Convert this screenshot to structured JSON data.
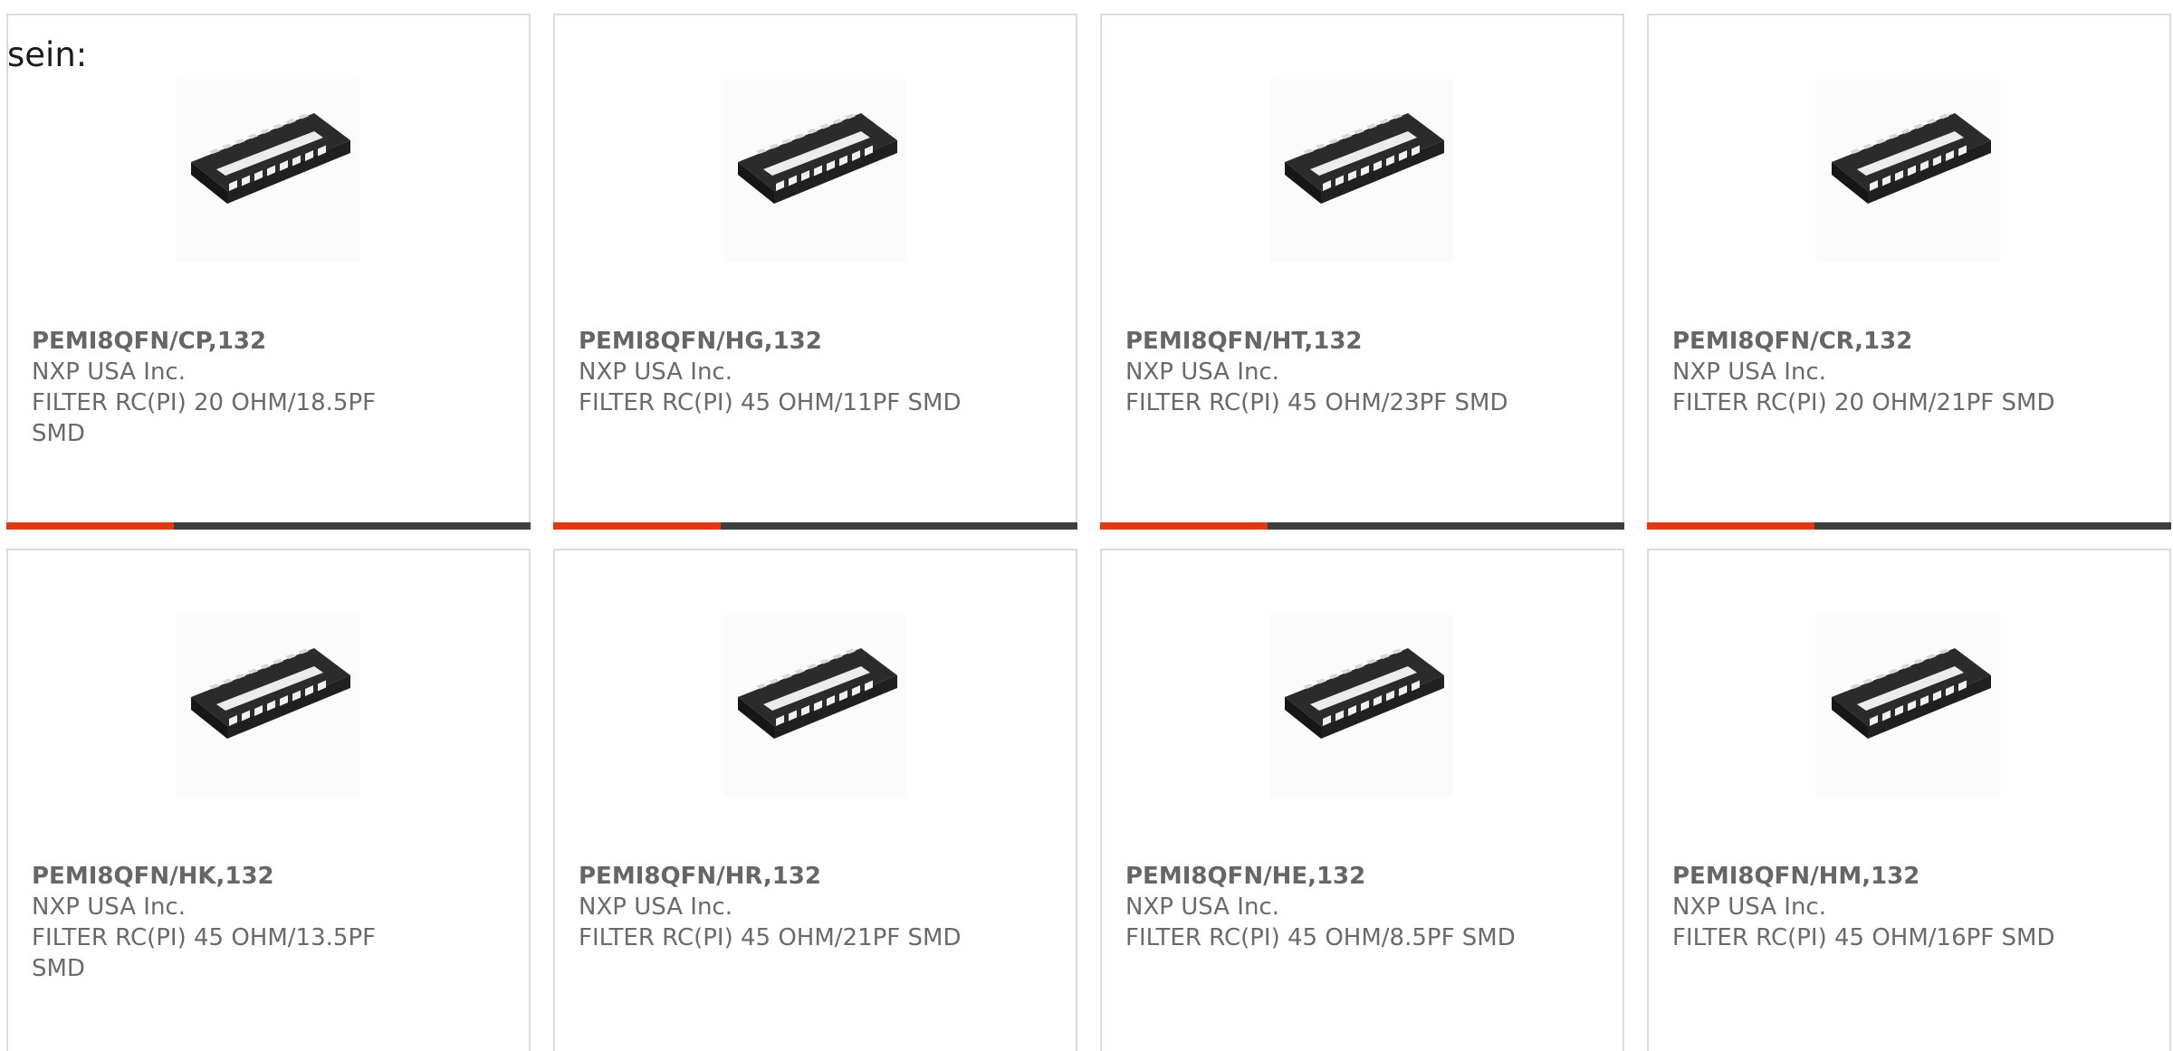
{
  "heading": "sein:",
  "colors": {
    "accent": "#e03a13",
    "track": "#3d3d3d",
    "card_border": "#dcdcdc",
    "text": "#6a6a6a"
  },
  "product_image_icon": "qfn-chip-package-icon",
  "products": [
    {
      "part_number": "PEMI8QFN/CP,132",
      "manufacturer": "NXP USA Inc.",
      "description": "FILTER RC(PI) 20 OHM/18.5PF SMD",
      "progress": 0.32
    },
    {
      "part_number": "PEMI8QFN/HG,132",
      "manufacturer": "NXP USA Inc.",
      "description": "FILTER RC(PI) 45 OHM/11PF SMD",
      "progress": 0.32
    },
    {
      "part_number": "PEMI8QFN/HT,132",
      "manufacturer": "NXP USA Inc.",
      "description": "FILTER RC(PI) 45 OHM/23PF SMD",
      "progress": 0.32
    },
    {
      "part_number": "PEMI8QFN/CR,132",
      "manufacturer": "NXP USA Inc.",
      "description": "FILTER RC(PI) 20 OHM/21PF SMD",
      "progress": 0.32
    },
    {
      "part_number": "PEMI8QFN/HK,132",
      "manufacturer": "NXP USA Inc.",
      "description": "FILTER RC(PI) 45 OHM/13.5PF SMD"
    },
    {
      "part_number": "PEMI8QFN/HR,132",
      "manufacturer": "NXP USA Inc.",
      "description": "FILTER RC(PI) 45 OHM/21PF SMD"
    },
    {
      "part_number": "PEMI8QFN/HE,132",
      "manufacturer": "NXP USA Inc.",
      "description": "FILTER RC(PI) 45 OHM/8.5PF SMD"
    },
    {
      "part_number": "PEMI8QFN/HM,132",
      "manufacturer": "NXP USA Inc.",
      "description": "FILTER RC(PI) 45 OHM/16PF SMD"
    }
  ]
}
